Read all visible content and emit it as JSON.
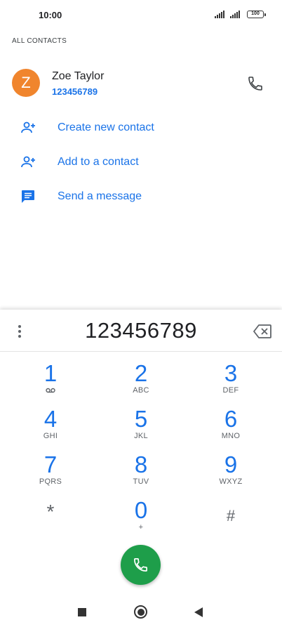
{
  "status_bar": {
    "time": "10:00",
    "battery": "100"
  },
  "contacts_header": "ALL CONTACTS",
  "contact": {
    "initial": "Z",
    "name": "Zoe Taylor",
    "number": "123456789",
    "avatar_color": "#f0852d"
  },
  "actions": [
    {
      "label": "Create new contact",
      "icon": "add-person-icon"
    },
    {
      "label": "Add to a contact",
      "icon": "add-person-icon"
    },
    {
      "label": "Send a message",
      "icon": "message-icon"
    }
  ],
  "dialpad": {
    "dialed_number": "123456789",
    "keys": [
      {
        "digit": "1",
        "letters": "",
        "sub_icon": "voicemail-icon"
      },
      {
        "digit": "2",
        "letters": "ABC"
      },
      {
        "digit": "3",
        "letters": "DEF"
      },
      {
        "digit": "4",
        "letters": "GHI"
      },
      {
        "digit": "5",
        "letters": "JKL"
      },
      {
        "digit": "6",
        "letters": "MNO"
      },
      {
        "digit": "7",
        "letters": "PQRS"
      },
      {
        "digit": "8",
        "letters": "TUV"
      },
      {
        "digit": "9",
        "letters": "WXYZ"
      },
      {
        "digit": "*",
        "letters": ""
      },
      {
        "digit": "0",
        "letters": "+"
      },
      {
        "digit": "#",
        "letters": ""
      }
    ]
  },
  "colors": {
    "accent": "#1a73e8",
    "call_button": "#1e9e4a",
    "secondary_text": "#5f6368"
  },
  "nav_icons": [
    "recents-square-icon",
    "home-circle-icon",
    "back-triangle-icon"
  ]
}
